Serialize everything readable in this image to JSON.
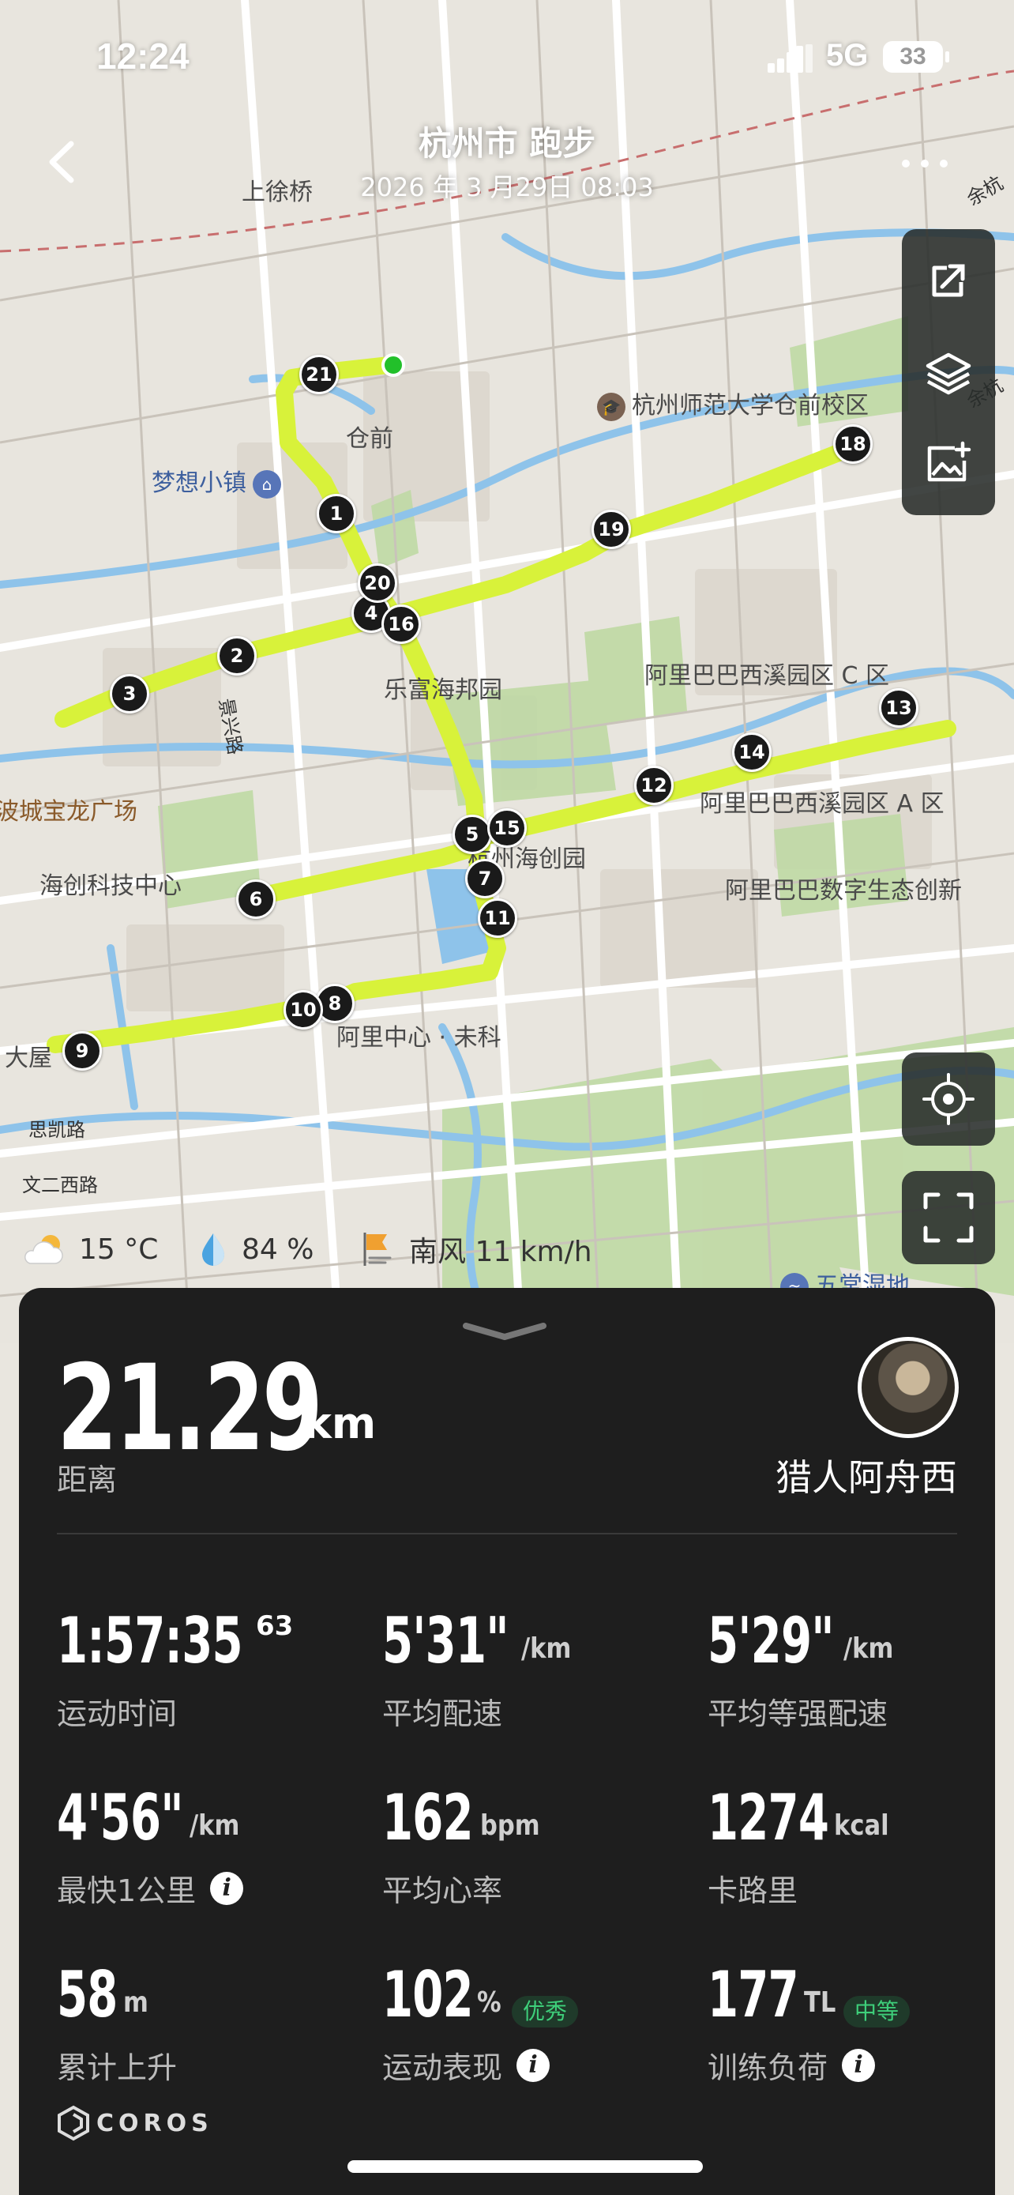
{
  "status_bar": {
    "time": "12:24",
    "network": "5G",
    "battery": "33"
  },
  "header": {
    "title": "杭州市 跑步",
    "datetime": "2026 年 3 月29日 08:03"
  },
  "map": {
    "route_color": "#d8f23a",
    "start_color": "#22c02a",
    "labels": {
      "shangxuqiao": "上徐桥",
      "canqian": "仓前",
      "mengxiang": "梦想小镇",
      "hznu": "杭州师范大学仓前校区",
      "lefu": "乐富海邦园",
      "ali_c": "阿里巴巴西溪园区 C 区",
      "ali_a": "阿里巴巴西溪园区 A 区",
      "baolong": "波城宝龙广场",
      "haichuang_center": "海创科技中心",
      "haichuang_park": "杭州海创园",
      "ali_digital": "阿里巴巴数字生态创新",
      "ali_center": "阿里中心 · 未科",
      "dawu": "大屋",
      "sikai": "思凯路",
      "wener": "文二西路",
      "yuhang": "余杭",
      "yuhang2": "余杭",
      "wuchang": "五常湿地",
      "jingxing": "景兴路"
    },
    "km_markers": [
      "1",
      "2",
      "3",
      "4",
      "5",
      "6",
      "7",
      "8",
      "9",
      "10",
      "11",
      "12",
      "13",
      "14",
      "15",
      "16",
      "18",
      "19",
      "20",
      "21"
    ]
  },
  "weather": {
    "temperature": "15 °C",
    "humidity": "84 %",
    "wind": "南风 11 km/h"
  },
  "summary": {
    "distance_value": "21.29",
    "distance_unit": "km",
    "distance_label": "距离",
    "username": "猎人阿舟西"
  },
  "stats": [
    {
      "value": "1:57:35",
      "sup": "63",
      "unit": "",
      "label": "运动时间"
    },
    {
      "value": "5'31\"",
      "unit": "/km",
      "label": "平均配速"
    },
    {
      "value": "5'29\"",
      "unit": "/km",
      "label": "平均等强配速"
    },
    {
      "value": "4'56\"",
      "unit": "/km",
      "label": "最快1公里"
    },
    {
      "value": "162",
      "unit": "bpm",
      "label": "平均心率"
    },
    {
      "value": "1274",
      "unit": "kcal",
      "label": "卡路里"
    },
    {
      "value": "58",
      "unit": "m",
      "label": "累计上升"
    },
    {
      "value": "102",
      "unit": "%",
      "label": "运动表现",
      "badge": "优秀"
    },
    {
      "value": "177",
      "unit": "TL",
      "label": "训练负荷",
      "badge": "中等"
    }
  ],
  "brand": "COROS",
  "colors": {
    "badge_text": "#3ecf7a",
    "badge_bg": "#1f3a2a",
    "sheet_bg": "#1e1e1e"
  }
}
